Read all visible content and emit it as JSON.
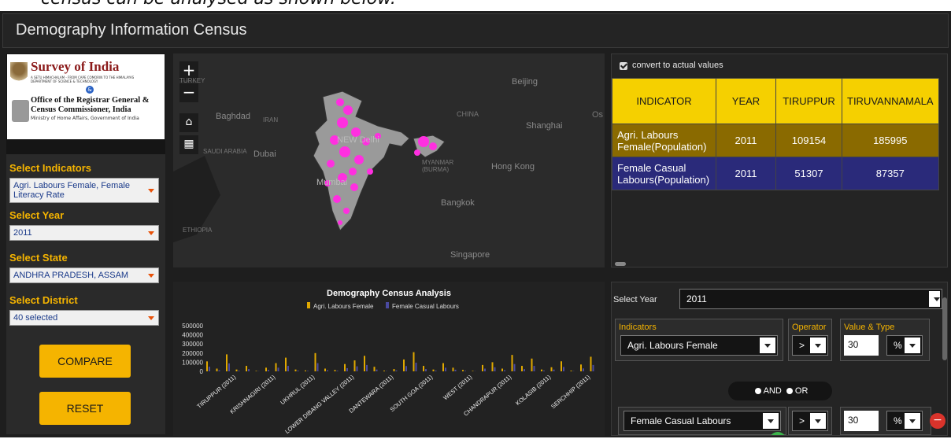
{
  "caption": "census can be analysed as shown below.",
  "app_title": "Demography Information Census",
  "logo": {
    "line1": "Survey of India",
    "line2": "A SETU HIMACHALAM - FROM CAPE COMORIN TO THE HIMALAYAS",
    "line3": "DEPARTMENT OF SCIENCE & TECHNOLOGY",
    "amp": "&",
    "line4": "Office of the Registrar General &",
    "line5": "Census Commissioner, India",
    "line6": "Ministry of Home Affairs, Government of India"
  },
  "filters": {
    "indicators_label": "Select Indicators",
    "indicators_value": "Agri. Labours Female, Female Literacy Rate",
    "year_label": "Select Year",
    "year_value": "2011",
    "state_label": "Select State",
    "state_value": "ANDHRA PRADESH, ASSAM",
    "district_label": "Select District",
    "district_value": "40 selected",
    "compare_label": "COMPARE",
    "reset_label": "RESET"
  },
  "map": {
    "zoom_in": "+",
    "zoom_out": "−",
    "labels": {
      "turkey": "TURKEY",
      "baghdad": "Baghdad",
      "iran": "IRAN",
      "saudi": "SAUDI ARABIA",
      "dubai": "Dubai",
      "ethiopia": "ETHIOPIA",
      "beijing": "Beijing",
      "china": "CHINA",
      "shanghai": "Shanghai",
      "newdelhi": "NEW Delhi",
      "myanmar": "MYANMAR (BURMA)",
      "hongkong": "Hong Kong",
      "mumbai": "Mumbai",
      "bangkok": "Bangkok",
      "singapore": "Singapore",
      "os": "Os"
    },
    "highlight_color": "#ff2fe0"
  },
  "table": {
    "checkbox_label": "convert to actual values",
    "headers": [
      "INDICATOR",
      "YEAR",
      "TIRUPPUR",
      "TIRUVANNAMALA"
    ],
    "rows": [
      [
        "Agri. Labours Female(Population)",
        "2011",
        "109154",
        "185995"
      ],
      [
        "Female Casual Labours(Population)",
        "2011",
        "51307",
        "87357"
      ]
    ]
  },
  "chart_data": {
    "type": "bar",
    "title": "Demography Census Analysis",
    "legend": [
      "Agri. Labours Female",
      "Female Casual Labours"
    ],
    "colors": [
      "#e0a800",
      "#4a4aa0"
    ],
    "y_ticks": [
      "500000",
      "400000",
      "300000",
      "200000",
      "100000",
      "0"
    ],
    "ylim": [
      0,
      500000
    ],
    "x_tick_labels": [
      "TIRUPPUR (2011)",
      "KRISHNAGIRI (2011)",
      "UKHRUL (2011)",
      "LOWER DIBANG VALLEY (2011)",
      "DANTEWARA (2011)",
      "SOUTH GOA (2011)",
      "WEST (2011)",
      "CHANDRAPUR (2011)",
      "KOLASIB (2011)",
      "SERCHHIP (2011)"
    ],
    "series": [
      {
        "name": "Agri. Labours Female",
        "values": [
          109154,
          30000,
          185995,
          20000,
          60000,
          5000,
          40000,
          90000,
          150000,
          20000,
          10000,
          200000,
          30000,
          15000,
          80000,
          120000,
          170000,
          50000,
          8000,
          25000,
          130000,
          210000,
          60000,
          20000,
          90000,
          40000,
          15000,
          5000,
          70000,
          100000,
          30000,
          180000,
          60000,
          140000,
          20000,
          45000,
          110000,
          8000,
          75000,
          160000
        ]
      },
      {
        "name": "Female Casual Labours",
        "values": [
          51307,
          12000,
          87357,
          8000,
          25000,
          2000,
          15000,
          40000,
          60000,
          9000,
          5000,
          90000,
          12000,
          7000,
          35000,
          55000,
          70000,
          20000,
          3000,
          10000,
          58000,
          95000,
          25000,
          9000,
          40000,
          18000,
          6000,
          2000,
          30000,
          45000,
          12000,
          80000,
          25000,
          60000,
          9000,
          20000,
          48000,
          3000,
          32000,
          70000
        ]
      }
    ]
  },
  "query": {
    "year_label": "Select Year",
    "year_value": "2011",
    "indicators_label": "Indicators",
    "operator_label": "Operator",
    "value_type_label": "Value & Type",
    "cond1": {
      "indicator": "Agri. Labours Female",
      "operator": ">",
      "value": "30",
      "type": "%"
    },
    "and_label": "AND",
    "or_label": "OR",
    "cond2": {
      "indicator": "Female Casual Labours",
      "operator": ">",
      "value": "30",
      "type": "%"
    },
    "remove_label": "−"
  }
}
